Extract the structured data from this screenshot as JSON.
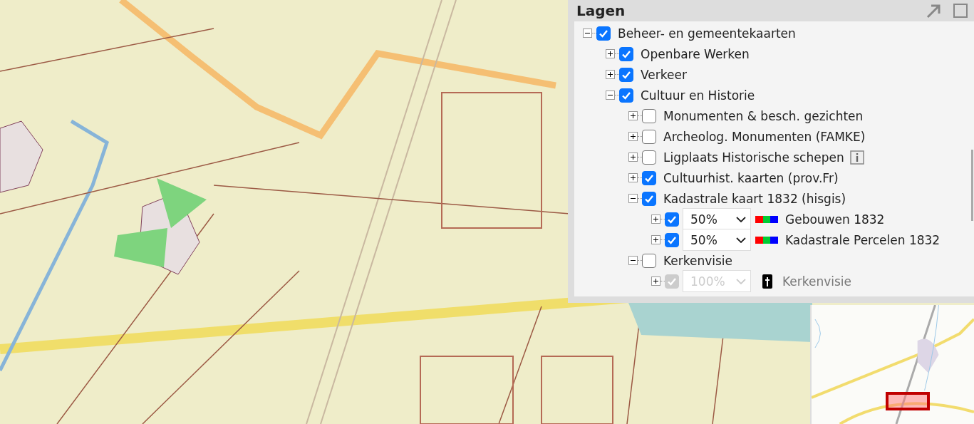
{
  "layers_panel": {
    "title": "Lagen",
    "tree": [
      {
        "kind": "layer",
        "label": "Beheer- en gemeentekaarten",
        "checked": true,
        "expanded": true,
        "children": [
          {
            "kind": "layer",
            "label": "Openbare Werken",
            "checked": true,
            "expanded": false
          },
          {
            "kind": "layer",
            "label": "Verkeer",
            "checked": true,
            "expanded": false
          },
          {
            "kind": "layer",
            "label": "Cultuur en Historie",
            "checked": true,
            "expanded": true,
            "children": [
              {
                "kind": "layer",
                "label": "Monumenten & besch. gezichten",
                "checked": false,
                "expanded": false
              },
              {
                "kind": "layer",
                "label": "Archeolog. Monumenten (FAMKE)",
                "checked": false,
                "expanded": false
              },
              {
                "kind": "layer",
                "label": "Ligplaats Historische schepen",
                "checked": false,
                "expanded": false,
                "info": true
              },
              {
                "kind": "layer",
                "label": "Cultuurhist. kaarten (prov.Fr)",
                "checked": true,
                "expanded": false
              },
              {
                "kind": "layer",
                "label": "Kadastrale kaart 1832 (hisgis)",
                "checked": true,
                "expanded": true,
                "children": [
                  {
                    "kind": "swatch",
                    "label": "Gebouwen 1832",
                    "checked": true,
                    "expanded": false,
                    "disabled": false,
                    "opacity": "50%"
                  },
                  {
                    "kind": "swatch",
                    "label": "Kadastrale Percelen 1832",
                    "checked": true,
                    "expanded": false,
                    "disabled": false,
                    "opacity": "50%"
                  }
                ]
              },
              {
                "kind": "layer",
                "label": "Kerkenvisie",
                "checked": false,
                "expanded": true,
                "children": [
                  {
                    "kind": "symbol",
                    "label": "Kerkenvisie",
                    "checked": true,
                    "expanded": false,
                    "disabled": true,
                    "opacity": "100%"
                  }
                ]
              }
            ]
          }
        ]
      }
    ]
  }
}
